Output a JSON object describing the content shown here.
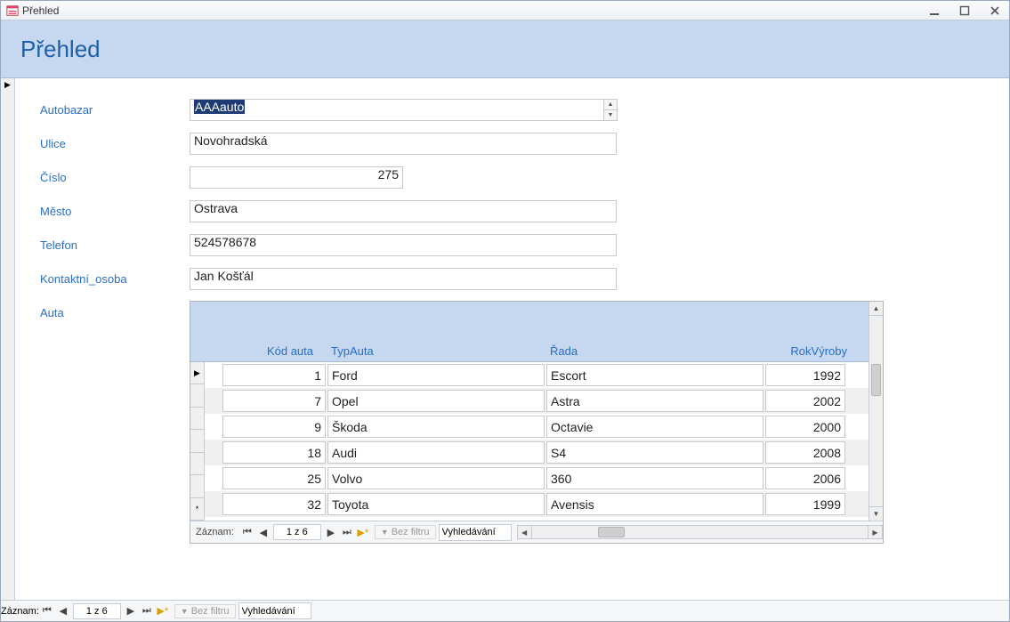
{
  "window": {
    "title": "Přehled"
  },
  "header": {
    "title": "Přehled"
  },
  "labels": {
    "autobazar": "Autobazar",
    "ulice": "Ulice",
    "cislo": "Číslo",
    "mesto": "Město",
    "telefon": "Telefon",
    "kontakt": "Kontaktní_osoba",
    "auta": "Auta"
  },
  "values": {
    "autobazar": "AAAauto",
    "ulice": "Novohradská",
    "cislo": "275",
    "mesto": "Ostrava",
    "telefon": "524578678",
    "kontakt": "Jan Košťál"
  },
  "subform": {
    "headers": {
      "kod": "Kód auta",
      "typ": "TypAuta",
      "rada": "Řada",
      "rok": "RokVýroby"
    },
    "rows": [
      {
        "kod": "1",
        "typ": "Ford",
        "rada": "Escort",
        "rok": "1992"
      },
      {
        "kod": "7",
        "typ": "Opel",
        "rada": "Astra",
        "rok": "2002"
      },
      {
        "kod": "9",
        "typ": "Škoda",
        "rada": "Octavie",
        "rok": "2000"
      },
      {
        "kod": "18",
        "typ": "Audi",
        "rada": "S4",
        "rok": "2008"
      },
      {
        "kod": "25",
        "typ": "Volvo",
        "rada": "360",
        "rok": "2006"
      },
      {
        "kod": "32",
        "typ": "Toyota",
        "rada": "Avensis",
        "rok": "1999"
      }
    ],
    "nav": {
      "label": "Záznam:",
      "counter": "1 z 6",
      "filter": "Bez filtru",
      "search": "Vyhledávání"
    }
  },
  "main_nav": {
    "label": "Záznam:",
    "counter": "1 z 6",
    "filter": "Bez filtru",
    "search": "Vyhledávání"
  }
}
